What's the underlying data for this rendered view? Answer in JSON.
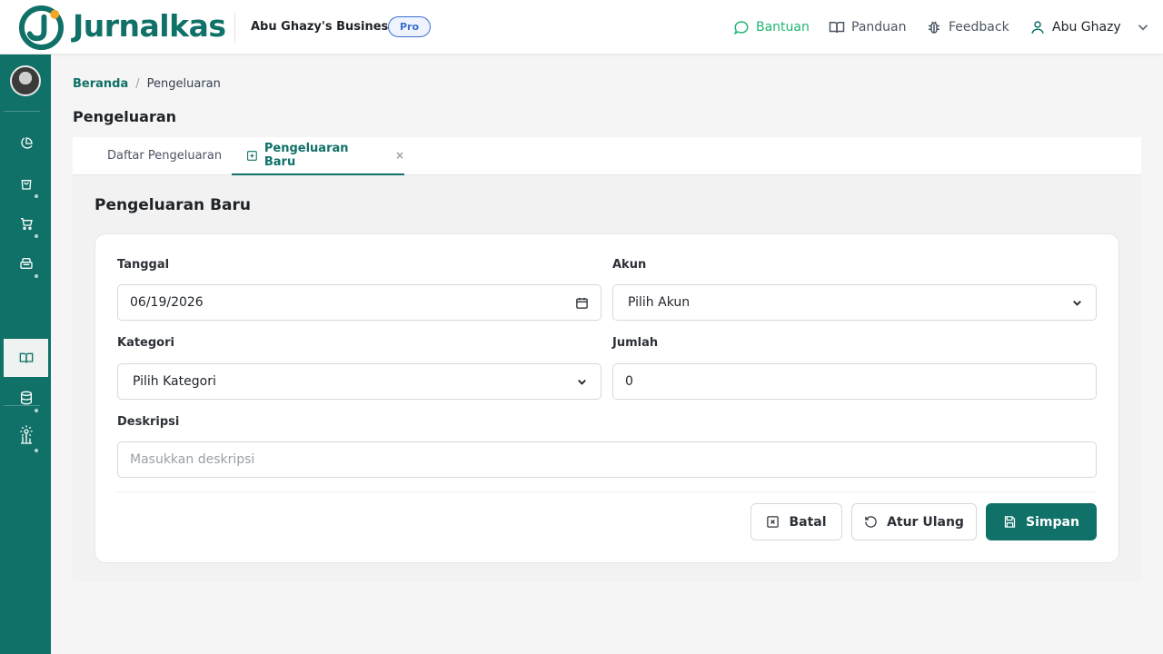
{
  "header": {
    "brand": "Jurnalkas",
    "business_name": "Abu Ghazy's Business",
    "plan_badge": "Pro",
    "links": {
      "help": "Bantuan",
      "guide": "Panduan",
      "feedback": "Feedback"
    },
    "user_name": "Abu Ghazy"
  },
  "sidebar": {
    "items": [
      {
        "icon": "pie-chart-icon"
      },
      {
        "icon": "shopping-bag-icon"
      },
      {
        "icon": "cart-icon"
      },
      {
        "icon": "cash-register-icon"
      },
      {
        "icon": "book-open-icon",
        "active": true
      },
      {
        "icon": "database-icon"
      },
      {
        "icon": "bar-chart-icon"
      },
      {
        "icon": "gear-icon"
      }
    ]
  },
  "breadcrumb": {
    "home": "Beranda",
    "separator": "/",
    "current": "Pengeluaran"
  },
  "page_title": "Pengeluaran",
  "tabs": {
    "list": "Daftar Pengeluaran",
    "new": "Pengeluaran Baru",
    "close": "×"
  },
  "form": {
    "title": "Pengeluaran Baru",
    "date_label": "Tanggal",
    "date_value": "06/19/2026",
    "account_label": "Akun",
    "account_value": "Pilih Akun",
    "category_label": "Kategori",
    "category_value": "Pilih Kategori",
    "amount_label": "Jumlah",
    "amount_value": "0",
    "description_label": "Deskripsi",
    "description_placeholder": "Masukkan deskripsi"
  },
  "buttons": {
    "cancel": "Batal",
    "reset": "Atur Ulang",
    "save": "Simpan"
  },
  "colors": {
    "primary": "#0f7168",
    "help_green": "#22b573",
    "badge_blue": "#3b6fd0"
  }
}
